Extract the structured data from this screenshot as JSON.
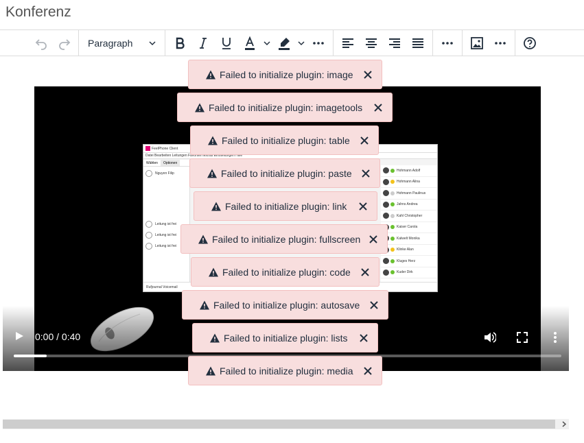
{
  "document": {
    "title": "Konferenz"
  },
  "toolbar": {
    "undo_icon": "undo-icon",
    "redo_icon": "redo-icon",
    "block_format": "Paragraph",
    "bold_icon": "bold-icon",
    "italic_icon": "italic-icon",
    "underline_icon": "underline-icon",
    "text_color_icon": "text-color-icon",
    "highlight_icon": "highlight-icon",
    "align_left_icon": "align-left-icon",
    "align_center_icon": "align-center-icon",
    "align_right_icon": "align-right-icon",
    "justify_icon": "justify-icon",
    "image_icon": "image-icon",
    "help_icon": "help-icon",
    "text_color": "#222f3e",
    "highlight_color": "#222f3e"
  },
  "video": {
    "time": "0:00 / 0:40",
    "progress": 0.06,
    "screenshot": {
      "window_title": "FeelPhone Client",
      "menu": "Datei   Bearbeiten   Leitungen   Favoriten   Extras   Einstellungen   Hilfe",
      "tabs": [
        "Wählen",
        "Optionen"
      ],
      "lines": [
        "Nguyen Filip",
        "Leitung ist frei",
        "Leitung ist frei",
        "Leitung ist frei"
      ],
      "bottom": "Rufjournal     Voicemail",
      "contacts": [
        "Hohmann Adolf",
        "Hohmann Alina",
        "Hohmann Paulinus",
        "Jahns Andrea",
        "Kahl Christopher",
        "Kaiser Carola",
        "Kalwelt Monika",
        "Klinke Alan",
        "Kluges Herz",
        "Kuder Dirk"
      ]
    }
  },
  "notifications": [
    "Failed to initialize plugin: image",
    "Failed to initialize plugin: imagetools",
    "Failed to initialize plugin: table",
    "Failed to initialize plugin: paste",
    "Failed to initialize plugin: link",
    "Failed to initialize plugin: fullscreen",
    "Failed to initialize plugin: code",
    "Failed to initialize plugin: autosave",
    "Failed to initialize plugin: lists",
    "Failed to initialize plugin: media"
  ],
  "colors": {
    "notification_bg": "#f8dede",
    "accent_brand": "#e20074"
  }
}
